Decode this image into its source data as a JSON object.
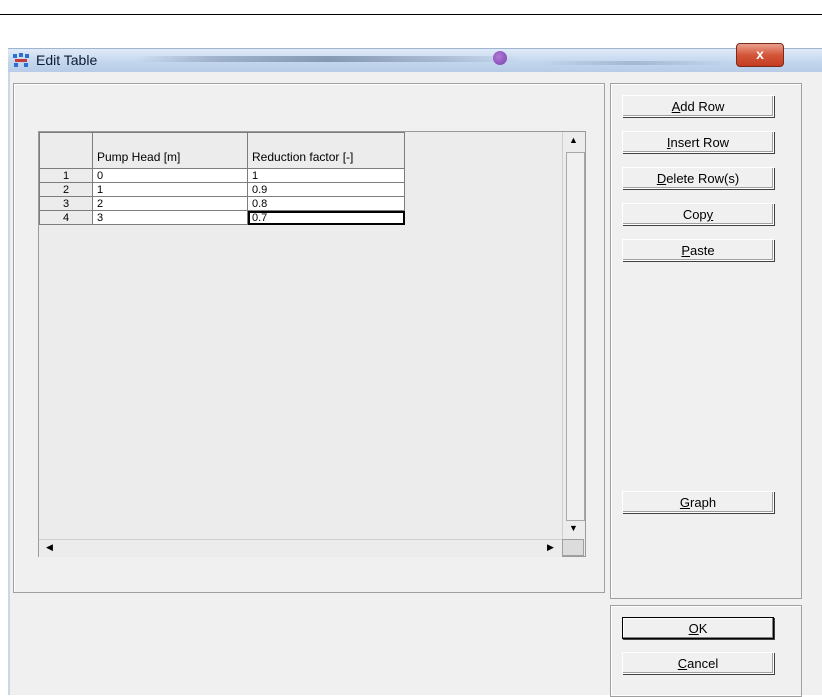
{
  "window": {
    "title": "Edit Table",
    "close_label": "x"
  },
  "table": {
    "columns": [
      "Pump Head [m]",
      "Reduction factor [-]"
    ],
    "rows": [
      {
        "index": "1",
        "pump_head": "0",
        "reduction_factor": "1"
      },
      {
        "index": "2",
        "pump_head": "1",
        "reduction_factor": "0.9"
      },
      {
        "index": "3",
        "pump_head": "2",
        "reduction_factor": "0.8"
      },
      {
        "index": "4",
        "pump_head": "3",
        "reduction_factor": "0.7"
      }
    ],
    "selected_cell": {
      "row": 4,
      "column": "Reduction factor [-]"
    }
  },
  "buttons": {
    "add_row": {
      "pre": "",
      "key": "A",
      "post": "dd Row"
    },
    "insert_row": {
      "pre": "",
      "key": "I",
      "post": "nsert Row"
    },
    "delete_rows": {
      "pre": "",
      "key": "D",
      "post": "elete Row(s)"
    },
    "copy": {
      "pre": "Cop",
      "key": "y",
      "post": ""
    },
    "paste": {
      "pre": "",
      "key": "P",
      "post": "aste"
    },
    "graph": {
      "pre": "",
      "key": "G",
      "post": "raph"
    },
    "ok": {
      "pre": "",
      "key": "O",
      "post": "K"
    },
    "cancel": {
      "pre": "",
      "key": "C",
      "post": "ancel"
    }
  },
  "colors": {
    "close_button": "#d4563a",
    "titlebar": "#c3d6ee",
    "dialog_bg": "#f0f0f0"
  },
  "icons": {
    "window_icon": "app-icon",
    "scroll_up": "arrow-up-icon",
    "scroll_down": "arrow-down-icon",
    "scroll_left": "arrow-left-icon",
    "scroll_right": "arrow-right-icon"
  }
}
